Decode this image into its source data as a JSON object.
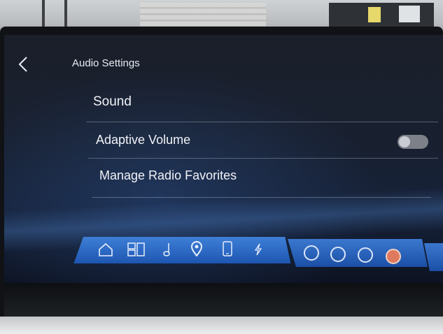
{
  "header": {
    "back_icon": "chevron-left-icon",
    "title": "Audio Settings"
  },
  "menu": {
    "items": [
      {
        "label": "Sound"
      },
      {
        "label": "Adaptive Volume",
        "toggle": false
      },
      {
        "label": "Manage Radio Favorites"
      }
    ]
  },
  "nav": {
    "main_icons": [
      "home-icon",
      "apps-grid-icon",
      "music-note-icon",
      "location-pin-icon",
      "phone-icon",
      "charging-bolt-icon"
    ],
    "app_icons": [
      "app-circle-1-icon",
      "app-circle-2-icon",
      "app-circle-3-icon",
      "app-circle-4-icon"
    ],
    "active_app_index": 3
  },
  "colors": {
    "nav_blue": "#1d56b2",
    "text": "#f1f2f6",
    "toggle_off": "#7d8088",
    "active_app": "#e07a5f"
  }
}
